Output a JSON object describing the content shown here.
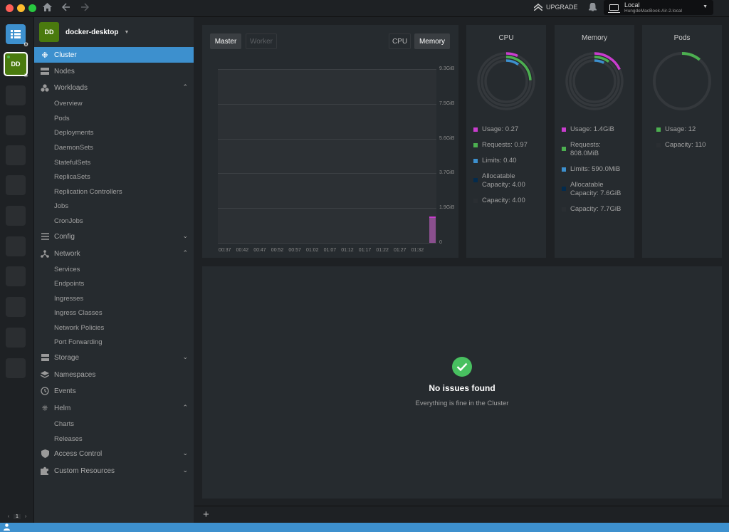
{
  "titlebar": {
    "upgrade_label": "UPGRADE",
    "context": {
      "name": "Local",
      "host": "HungdeMacBook-Air-2.local"
    }
  },
  "hotbar": {
    "active_cluster_initials": "DD",
    "pager": {
      "page": "1",
      "prev": "‹",
      "next": "›"
    }
  },
  "sidebar": {
    "cluster_initials": "DD",
    "cluster_name": "docker-desktop",
    "items": {
      "cluster": "Cluster",
      "nodes": "Nodes",
      "workloads": "Workloads",
      "workloads_sub": [
        "Overview",
        "Pods",
        "Deployments",
        "DaemonSets",
        "StatefulSets",
        "ReplicaSets",
        "Replication Controllers",
        "Jobs",
        "CronJobs"
      ],
      "config": "Config",
      "network": "Network",
      "network_sub": [
        "Services",
        "Endpoints",
        "Ingresses",
        "Ingress Classes",
        "Network Policies",
        "Port Forwarding"
      ],
      "storage": "Storage",
      "namespaces": "Namespaces",
      "events": "Events",
      "helm": "Helm",
      "helm_sub": [
        "Charts",
        "Releases"
      ],
      "access_control": "Access Control",
      "custom_resources": "Custom Resources"
    }
  },
  "metrics": {
    "tabs": {
      "master": "Master",
      "worker": "Worker",
      "cpu": "CPU",
      "memory": "Memory"
    },
    "chart_data": {
      "type": "bar",
      "y_ticks": [
        "9.3GiB",
        "7.5GiB",
        "5.6GiB",
        "3.7GiB",
        "1.9GiB",
        "0"
      ],
      "x_ticks": [
        "00:37",
        "00:42",
        "00:47",
        "00:52",
        "00:57",
        "01:02",
        "01:07",
        "01:12",
        "01:17",
        "01:22",
        "01:27",
        "01:32"
      ],
      "ylim": [
        0,
        9.3
      ],
      "values": [
        {
          "x": "01:34",
          "y": 1.4
        }
      ],
      "color": "#8a4f8e"
    }
  },
  "cards": {
    "cpu": {
      "title": "CPU",
      "legend": [
        {
          "label": "Usage: 0.27",
          "color": "#c93dce"
        },
        {
          "label": "Requests: 0.97",
          "color": "#4caf50"
        },
        {
          "label": "Limits: 0.40",
          "color": "#3d90ce"
        },
        {
          "label": "Allocatable Capacity: 4.00",
          "color": "#032b4d"
        },
        {
          "label": "Capacity: 4.00",
          "color": "#2a2e32"
        }
      ],
      "ring_fractions": [
        0.0675,
        0.2425,
        0.1
      ]
    },
    "memory": {
      "title": "Memory",
      "legend": [
        {
          "label": "Usage: 1.4GiB",
          "color": "#c93dce"
        },
        {
          "label": "Requests: 808.0MiB",
          "color": "#4caf50"
        },
        {
          "label": "Limits: 590.0MiB",
          "color": "#3d90ce"
        },
        {
          "label": "Allocatable Capacity: 7.6GiB",
          "color": "#032b4d"
        },
        {
          "label": "Capacity: 7.7GiB",
          "color": "#2a2e32"
        }
      ],
      "ring_fractions": [
        0.18,
        0.1,
        0.075
      ]
    },
    "pods": {
      "title": "Pods",
      "legend": [
        {
          "label": "Usage: 12",
          "color": "#4caf50"
        },
        {
          "label": "Capacity: 110",
          "color": "#2a2e32"
        }
      ],
      "ring_fractions": [
        0.109
      ]
    }
  },
  "issues": {
    "title": "No issues found",
    "subtitle": "Everything is fine in the Cluster"
  },
  "colors": {
    "accent": "#3d90ce",
    "success": "#48c060",
    "cluster_avatar": "#4a7a0e"
  }
}
